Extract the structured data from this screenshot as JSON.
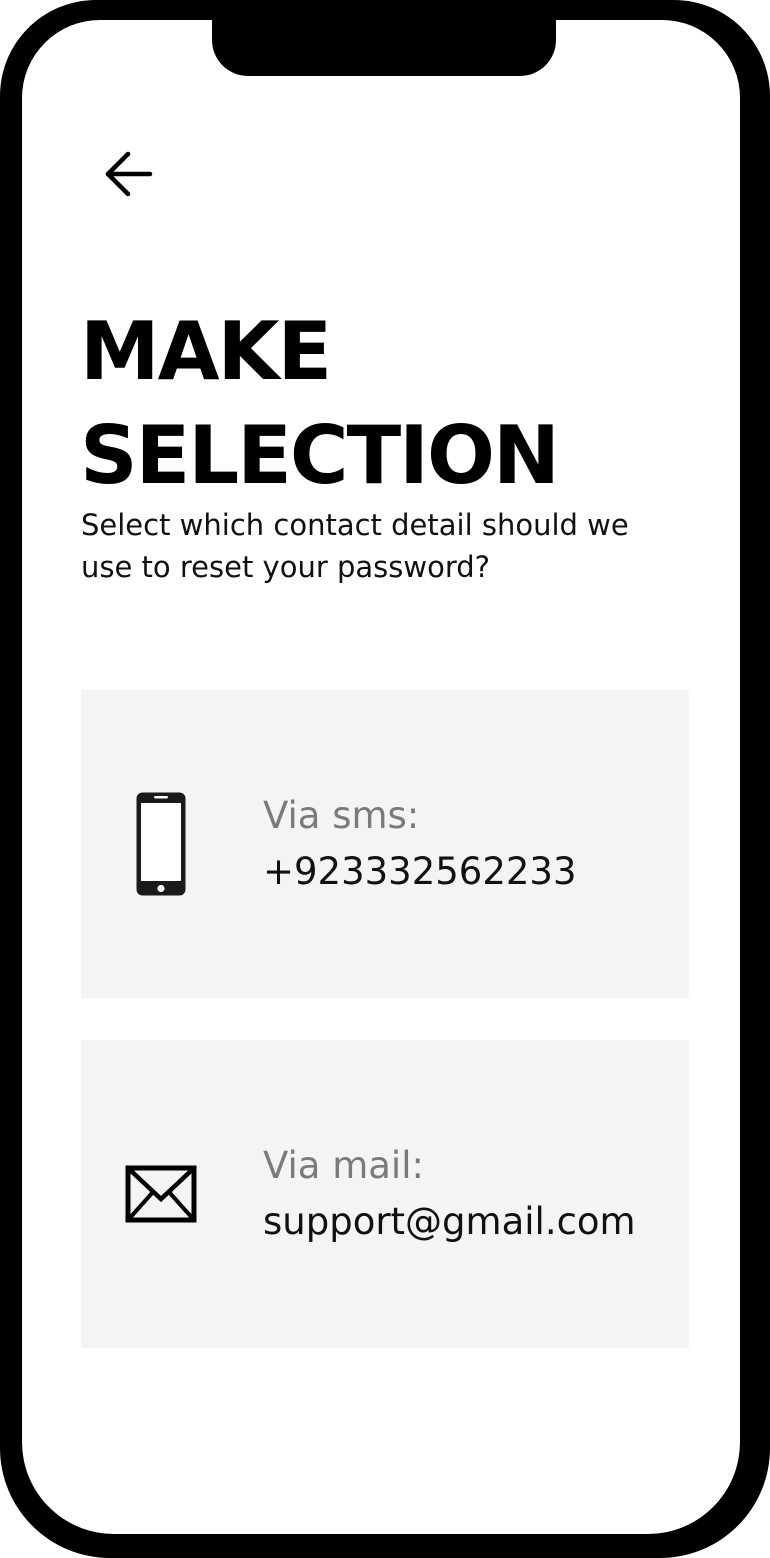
{
  "header": {
    "back_icon": "arrow-left-icon"
  },
  "title": {
    "line1": "MAKE",
    "line2": "SELECTION"
  },
  "subtitle": {
    "line1": "Select which contact detail should we",
    "line2": "use to reset your password?"
  },
  "options": [
    {
      "icon": "smartphone-icon",
      "label": "Via sms:",
      "value": "+923332562233"
    },
    {
      "icon": "envelope-icon",
      "label": "Via mail:",
      "value": "support@gmail.com"
    }
  ],
  "colors": {
    "text": "#000000",
    "label": "#7a7a7a",
    "card_background": "#f4f4f4",
    "frame": "#000000"
  }
}
